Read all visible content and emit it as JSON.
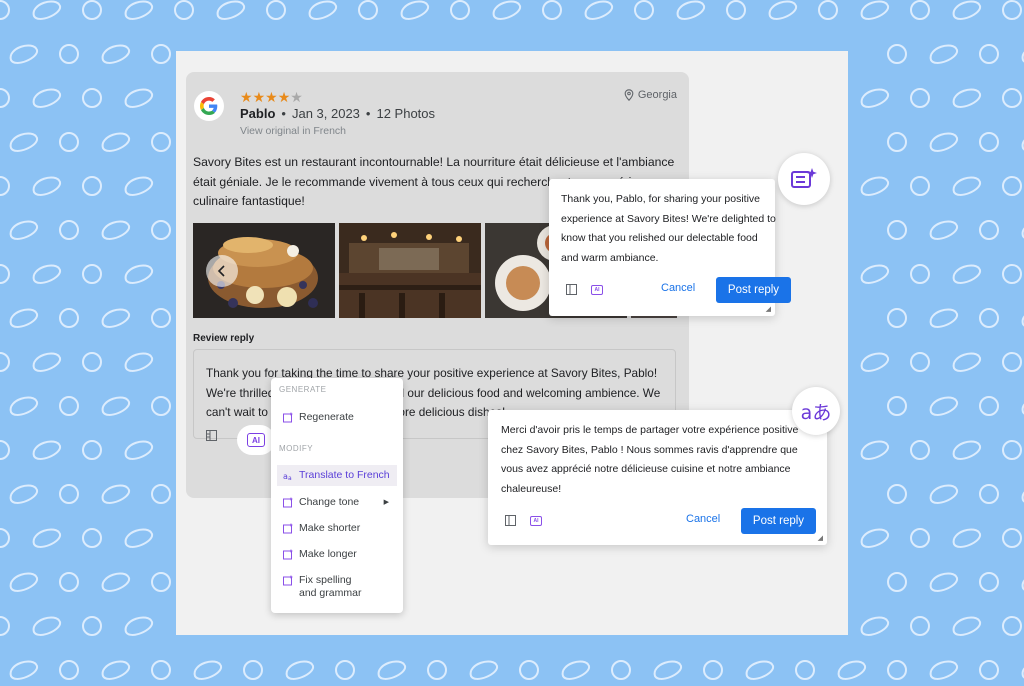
{
  "colors": {
    "background": "#8cc2f4",
    "accent": "#1a73e8",
    "ai": "#7b3fe4",
    "star": "#e88a1a"
  },
  "review": {
    "rating": 4,
    "max_rating": 5,
    "reviewer": "Pablo",
    "date": "Jan 3, 2023",
    "photos_count": "12 Photos",
    "view_original": "View original in French",
    "location": "Georgia",
    "text": "Savory Bites est un restaurant incontournable! La nourriture était délicieuse et l'ambiance était géniale. Je le recommande vivement à tous ceux qui recherchent une expérience culinaire fantastique!"
  },
  "reply": {
    "heading": "Review reply",
    "text": "Thank you for taking the time to share your positive experience at Savory Bites, Pablo! We're thrilled to hear that you enjoyed our delicious food and welcoming ambience. We can't wait to welcome you back for more delicious dishes!",
    "ai_label": "AI"
  },
  "menu": {
    "generate_label": "GENERATE",
    "modify_label": "MODIFY",
    "regenerate": "Regenerate",
    "translate": "Translate to French",
    "change_tone": "Change tone",
    "shorter": "Make shorter",
    "longer": "Make longer",
    "fix": "Fix spelling and grammar"
  },
  "popup_en": {
    "text": "Thank you, Pablo, for sharing your positive experience at Savory Bites! We're delighted to know that you relished our delectable food and warm ambiance.",
    "cancel": "Cancel",
    "post": "Post reply",
    "ai_label": "AI"
  },
  "popup_fr": {
    "text": "Merci d'avoir pris le temps de partager votre expérience positive chez Savory Bites, Pablo ! Nous sommes ravis d'apprendre que vous avez apprécié notre délicieuse cuisine et notre ambiance chaleureuse!",
    "cancel": "Cancel",
    "post": "Post reply",
    "ai_label": "AI",
    "translate_icon": "aあ"
  },
  "icons": [
    "google-logo",
    "location-pin-icon",
    "chevron-left-icon",
    "template-icon",
    "ai-icon",
    "sparkle-edit-icon",
    "translate-icon"
  ]
}
